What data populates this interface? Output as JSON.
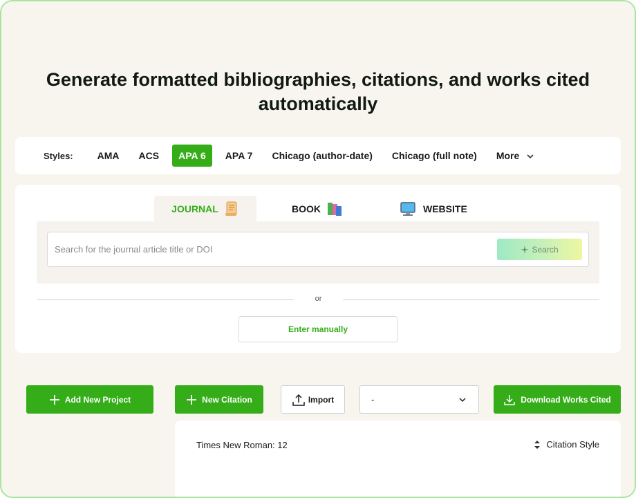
{
  "headline": "Generate formatted bibliographies, citations, and works cited automatically",
  "styles_bar": {
    "label": "Styles:",
    "options": [
      "AMA",
      "ACS",
      "APA 6",
      "APA 7",
      "Chicago (author-date)",
      "Chicago (full note)"
    ],
    "active": "APA 6",
    "more_label": "More"
  },
  "source_tabs": {
    "journal": "JOURNAL",
    "book": "BOOK",
    "website": "WEBSITE",
    "active": "JOURNAL"
  },
  "search": {
    "placeholder": "Search for the journal article title or DOI",
    "value": "",
    "button_label": "Search"
  },
  "divider_text": "or",
  "manual_button": "Enter manually",
  "actions": {
    "add_project": "Add New Project",
    "new_citation": "New Citation",
    "import": "Import",
    "project_select": "-",
    "download": "Download Works Cited"
  },
  "citation_panel": {
    "font_info": "Times New Roman: 12",
    "sort_label": "Citation Style"
  },
  "colors": {
    "accent": "#35ad19",
    "background": "#f8f5ee",
    "frame_border": "#a8e6a0"
  }
}
